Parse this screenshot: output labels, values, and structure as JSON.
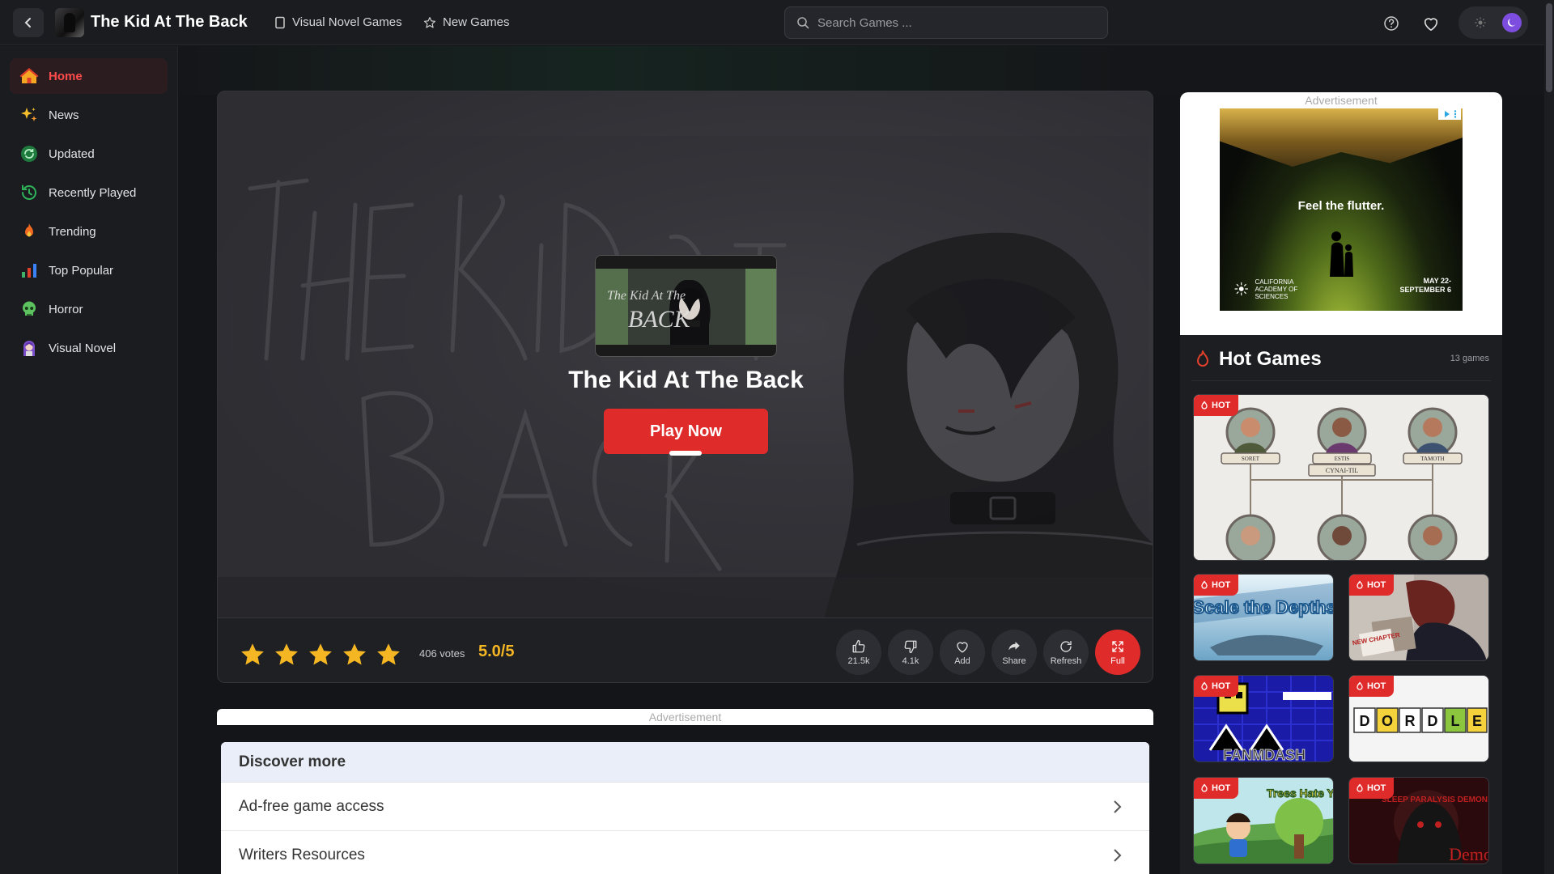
{
  "header": {
    "title": "The Kid At The Back",
    "nav": [
      {
        "label": "Visual Novel Games",
        "icon": "bookmark-icon"
      },
      {
        "label": "New Games",
        "icon": "star-icon"
      }
    ],
    "search_placeholder": "Search Games ..."
  },
  "sidebar": {
    "items": [
      {
        "label": "Home",
        "icon": "home-icon",
        "active": true
      },
      {
        "label": "News",
        "icon": "sparkle-icon"
      },
      {
        "label": "Updated",
        "icon": "refresh-badge-icon"
      },
      {
        "label": "Recently Played",
        "icon": "history-icon"
      },
      {
        "label": "Trending",
        "icon": "flame-icon"
      },
      {
        "label": "Top Popular",
        "icon": "bar-chart-icon"
      },
      {
        "label": "Horror",
        "icon": "skull-icon"
      },
      {
        "label": "Visual Novel",
        "icon": "anime-girl-icon"
      }
    ]
  },
  "game": {
    "title": "The Kid At The Back",
    "cover_text": "The Kid At The BACK",
    "play_label": "Play Now",
    "rating": {
      "stars": 5,
      "votes": "406 votes",
      "score": "5.0/5"
    },
    "actions": [
      {
        "label": "21.5k",
        "icon": "thumbs-up-icon"
      },
      {
        "label": "4.1k",
        "icon": "thumbs-down-icon"
      },
      {
        "label": "Add",
        "icon": "heart-icon"
      },
      {
        "label": "Share",
        "icon": "share-icon"
      },
      {
        "label": "Refresh",
        "icon": "refresh-icon"
      },
      {
        "label": "Full",
        "icon": "fullscreen-icon"
      }
    ]
  },
  "ads": {
    "label": "Advertisement",
    "side_ad": {
      "headline": "Feel the flutter.",
      "org": "CALIFORNIA ACADEMY OF SCIENCES",
      "dates": "MAY 22- SEPTEMBER 6"
    }
  },
  "discover": {
    "title": "Discover more",
    "items": [
      "Ad-free game access",
      "Writers Resources"
    ]
  },
  "hot_games": {
    "title": "Hot Games",
    "count": "13 games",
    "tag": "HOT",
    "tiles": [
      {
        "name": "family-tree-game",
        "caption_labels": [
          "SORET",
          "ESTIS",
          "CYNAI-TIL",
          "TAMOTH"
        ]
      },
      {
        "name": "scale-the-depths",
        "caption": "Scale the Depths"
      },
      {
        "name": "new-chapter-game",
        "caption": "NEW CHAPTER"
      },
      {
        "name": "fanmdash",
        "caption": "FANMDASH"
      },
      {
        "name": "dordle",
        "letters": [
          "D",
          "O",
          "R",
          "D",
          "L",
          "E"
        ]
      },
      {
        "name": "trees-hate-you",
        "caption": "Trees Hate You"
      },
      {
        "name": "sleep-paralysis-demon",
        "caption": "Demo",
        "subcaption": "SLEEP PARALYSIS DEMON"
      }
    ]
  },
  "colors": {
    "accent": "#e02b2b",
    "score": "#f5b623",
    "active_nav": "#ff4b4b"
  }
}
